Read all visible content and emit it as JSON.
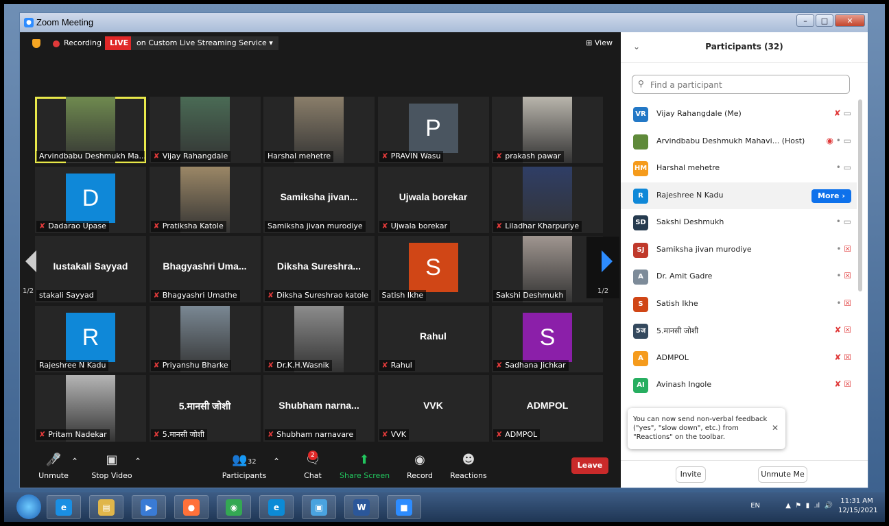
{
  "window": {
    "title": "Zoom Meeting"
  },
  "topbar": {
    "recording_label": "Recording",
    "live_label": "LIVE",
    "stream_label": "on Custom Live Streaming Service ▾",
    "view_label": "⊞ View"
  },
  "grid": {
    "page_label_left": "1/2",
    "page_label_right": "1/2",
    "tiles": [
      {
        "type": "photo",
        "label": "Arvindbabu Deshmukh Ma...",
        "muted": false,
        "active": true,
        "photo_color": "#6f8a4f"
      },
      {
        "type": "photo",
        "label": "Vijay Rahangdale",
        "muted": true,
        "photo_color": "#4a6b55"
      },
      {
        "type": "photo",
        "label": "Harshal mehetre",
        "muted": false,
        "photo_color": "#8a7e6a"
      },
      {
        "type": "avatar",
        "letter": "P",
        "color": "#4a5560",
        "label": "PRAVIN Wasu",
        "muted": true
      },
      {
        "type": "photo",
        "label": "prakash pawar",
        "muted": true,
        "photo_color": "#b9b5ac"
      },
      {
        "type": "avatar",
        "letter": "D",
        "color": "#0f88d8",
        "label": "Dadarao Upase",
        "muted": true
      },
      {
        "type": "photo",
        "label": "Pratiksha Katole",
        "muted": true,
        "photo_color": "#9b8766"
      },
      {
        "type": "name",
        "bigname": "Samiksha  jivan...",
        "label": "Samiksha jivan murodiye",
        "muted": false
      },
      {
        "type": "name",
        "bigname": "Ujwala borekar",
        "label": "Ujwala borekar",
        "muted": true
      },
      {
        "type": "photo",
        "label": "Liladhar Kharpuriye",
        "muted": true,
        "photo_color": "#2f3e66"
      },
      {
        "type": "name",
        "bigname": "Iustakali Sayyad",
        "label": "stakali Sayyad",
        "muted": false
      },
      {
        "type": "name",
        "bigname": "Bhagyashri  Uma...",
        "label": "Bhagyashri Umathe",
        "muted": true
      },
      {
        "type": "name",
        "bigname": "Diksha  Sureshra...",
        "label": "Diksha Sureshrao katole",
        "muted": true
      },
      {
        "type": "avatar",
        "letter": "S",
        "color": "#d04616",
        "label": "Satish Ikhe",
        "muted": false
      },
      {
        "type": "photo",
        "label": "Sakshi Deshmukh",
        "muted": false,
        "photo_color": "#a09690"
      },
      {
        "type": "avatar",
        "letter": "R",
        "color": "#0f88d8",
        "label": "Rajeshree N Kadu",
        "muted": false
      },
      {
        "type": "photo",
        "label": "Priyanshu Bharke",
        "muted": true,
        "photo_color": "#7a8894"
      },
      {
        "type": "photo",
        "label": "Dr.K.H.Wasnik",
        "muted": true,
        "photo_color": "#8c8c8c"
      },
      {
        "type": "name",
        "bigname": "Rahul",
        "label": "Rahul",
        "muted": true
      },
      {
        "type": "avatar",
        "letter": "S",
        "color": "#8b1fa9",
        "label": "Sadhana Jichkar",
        "muted": true
      },
      {
        "type": "photo",
        "label": "Pritam Nadekar",
        "muted": true,
        "photo_color": "#b5b5b5"
      },
      {
        "type": "name",
        "bigname": "5.मानसी जोशी",
        "label": "5.मानसी जोशी",
        "muted": true
      },
      {
        "type": "name",
        "bigname": "Shubham  narna...",
        "label": "Shubham narnavare",
        "muted": true
      },
      {
        "type": "name",
        "bigname": "VVK",
        "label": "VVK",
        "muted": true
      },
      {
        "type": "name",
        "bigname": "ADMPOL",
        "label": "ADMPOL",
        "muted": true
      }
    ]
  },
  "toolbar": {
    "unmute": "Unmute",
    "stop_video": "Stop Video",
    "participants": "Participants",
    "participants_count": "32",
    "chat": "Chat",
    "chat_badge": "2",
    "share_screen": "Share Screen",
    "record": "Record",
    "reactions": "Reactions",
    "leave": "Leave"
  },
  "panel": {
    "title": "Participants (32)",
    "search_placeholder": "Find a participant",
    "more_label": "More ›",
    "participants": [
      {
        "initials": "VR",
        "color": "#2378c6",
        "name": "Vijay Rahangdale (Me)",
        "mic": "muted",
        "video": "on"
      },
      {
        "initials": "",
        "color": "#5f8a3a",
        "name": "Arvindbabu Deshmukh Mahavi...  (Host)",
        "mic": "on",
        "video": "on",
        "recording": true
      },
      {
        "initials": "HM",
        "color": "#f59b1c",
        "name": "Harshal mehetre",
        "mic": "on",
        "video": "on"
      },
      {
        "initials": "R",
        "color": "#0f88d8",
        "name": "Rajeshree N Kadu",
        "mic": "",
        "video": "",
        "more": true
      },
      {
        "initials": "SD",
        "color": "#263b4f",
        "name": "Sakshi Deshmukh",
        "mic": "on",
        "video": "on"
      },
      {
        "initials": "SJ",
        "color": "#c0392b",
        "name": "Samiksha jivan murodiye",
        "mic": "on",
        "video": "off"
      },
      {
        "initials": "A",
        "color": "#7d8b99",
        "name": "Dr. Amit Gadre",
        "mic": "on",
        "video": "off"
      },
      {
        "initials": "S",
        "color": "#d04616",
        "name": "Satish Ikhe",
        "mic": "on",
        "video": "off"
      },
      {
        "initials": "5ज",
        "color": "#34495e",
        "name": "5.मानसी जोशी",
        "mic": "muted",
        "video": "off"
      },
      {
        "initials": "A",
        "color": "#f59b1c",
        "name": "ADMPOL",
        "mic": "muted",
        "video": "off"
      },
      {
        "initials": "AI",
        "color": "#27ae60",
        "name": "Avinash Ingole",
        "mic": "muted",
        "video": "off"
      }
    ],
    "tooltip": "You can now send non-verbal feedback (\"yes\", \"slow down\", etc.) from \"Reactions\" on the toolbar.",
    "invite": "Invite",
    "unmute_me": "Unmute Me"
  },
  "taskbar": {
    "lang": "EN",
    "time": "11:31 AM",
    "date": "12/15/2021",
    "apps": [
      {
        "name": "ie-icon",
        "glyph": "e",
        "color": "#1a8fe3"
      },
      {
        "name": "file-explorer-icon",
        "glyph": "▤",
        "color": "#e0b64a"
      },
      {
        "name": "media-player-icon",
        "glyph": "▶",
        "color": "#3a7bd5"
      },
      {
        "name": "firefox-icon",
        "glyph": "●",
        "color": "#ff7139"
      },
      {
        "name": "chrome-icon",
        "glyph": "◉",
        "color": "#34a853"
      },
      {
        "name": "edge-icon",
        "glyph": "e",
        "color": "#0c8bd6"
      },
      {
        "name": "image-viewer-icon",
        "glyph": "▣",
        "color": "#4aa3df"
      },
      {
        "name": "word-icon",
        "glyph": "W",
        "color": "#2b579a"
      },
      {
        "name": "zoom-icon",
        "glyph": "■",
        "color": "#2d8cff"
      }
    ]
  }
}
